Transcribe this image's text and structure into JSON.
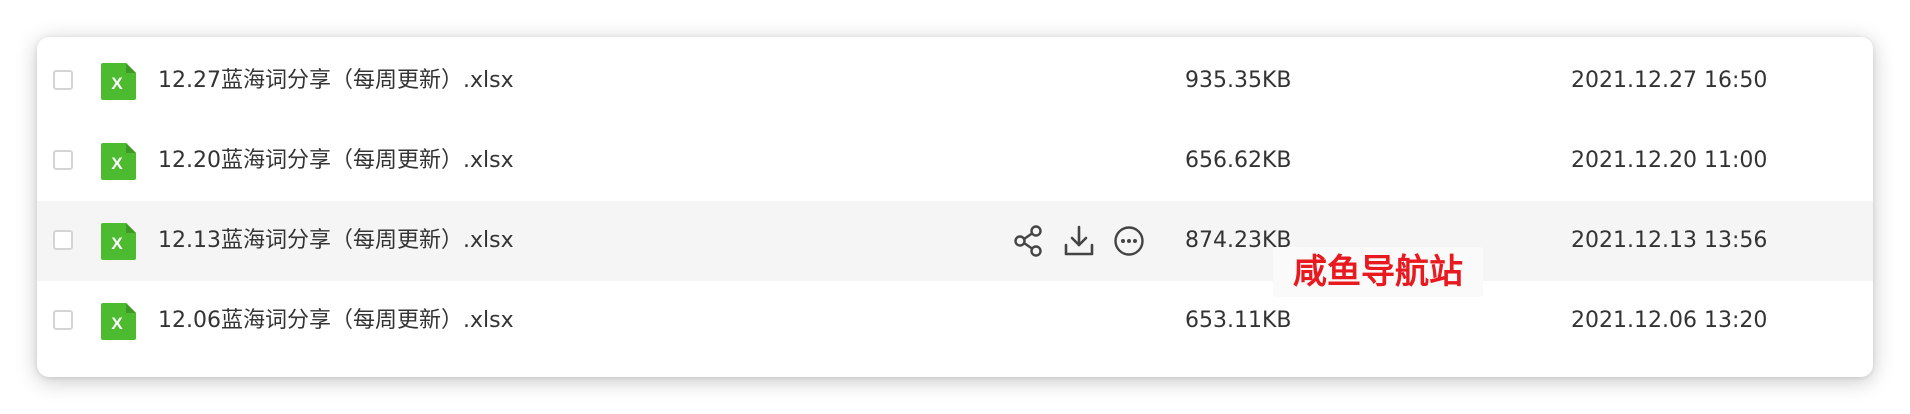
{
  "files": [
    {
      "name": "12.27蓝海词分享（每周更新）.xlsx",
      "size": "935.35KB",
      "date": "2021.12.27 16:50"
    },
    {
      "name": "12.20蓝海词分享（每周更新）.xlsx",
      "size": "656.62KB",
      "date": "2021.12.20 11:00"
    },
    {
      "name": "12.13蓝海词分享（每周更新）.xlsx",
      "size": "874.23KB",
      "date": "2021.12.13 13:56"
    },
    {
      "name": "12.06蓝海词分享（每周更新）.xlsx",
      "size": "653.11KB",
      "date": "2021.12.06 13:20"
    }
  ],
  "file_icon": {
    "name": "excel-file-icon",
    "glyph": "X",
    "color": "#4dbb2f"
  },
  "row_actions": {
    "icons": [
      "share-icon",
      "download-icon",
      "more-icon"
    ],
    "visible_on_row": 3
  },
  "watermark": {
    "text": "咸鱼导航站",
    "color": "#e8191f"
  },
  "colors": {
    "text": "#333333",
    "hover_row": "#f5f5f5",
    "checkbox_border": "#d4d4d4",
    "icon_stroke": "#444444"
  }
}
